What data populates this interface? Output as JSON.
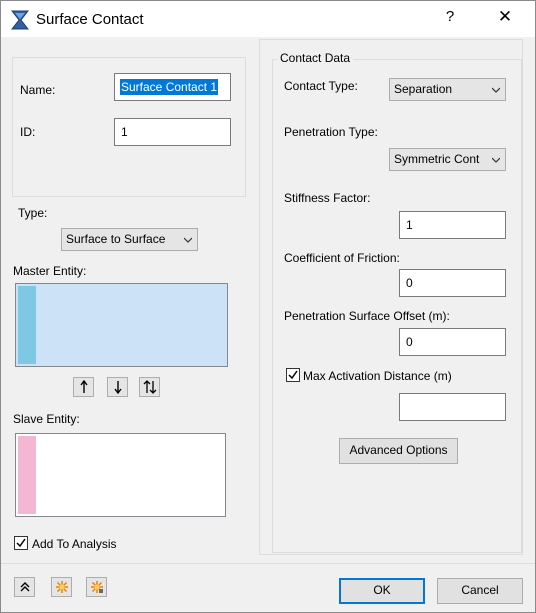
{
  "window": {
    "title": "Surface Contact",
    "help_glyph": "?",
    "close_glyph": "✕"
  },
  "general": {
    "name_label": "Name:",
    "name_value": "Surface Contact 1",
    "id_label": "ID:",
    "id_value": "1"
  },
  "type": {
    "label": "Type:",
    "value": "Surface to Surface"
  },
  "master": {
    "label": "Master Entity:",
    "strip_color": "#7ec8e3",
    "fill_color": "#cce3f7"
  },
  "slave": {
    "label": "Slave Entity:",
    "strip_color": "#f4b7d3"
  },
  "add_to_analysis": {
    "label": "Add To Analysis",
    "checked": true
  },
  "contact_data": {
    "group_label": "Contact Data",
    "contact_type_label": "Contact Type:",
    "contact_type_value": "Separation",
    "penetration_type_label": "Penetration Type:",
    "penetration_type_value": "Symmetric Cont",
    "stiffness_label": "Stiffness Factor:",
    "stiffness_value": "1",
    "friction_label": "Coefficient of Friction:",
    "friction_value": "0",
    "offset_label": "Penetration Surface Offset (m):",
    "offset_value": "0",
    "max_activation_label": "Max Activation Distance (m)",
    "max_activation_checked": true,
    "max_activation_value": "",
    "advanced_button": "Advanced Options"
  },
  "footer": {
    "ok": "OK",
    "cancel": "Cancel",
    "icons": [
      "collapse-up-icon",
      "burst-icon",
      "burst-settings-icon"
    ]
  },
  "colors": {
    "accent": "#0078d7",
    "icon_orange": "#f07d00"
  }
}
